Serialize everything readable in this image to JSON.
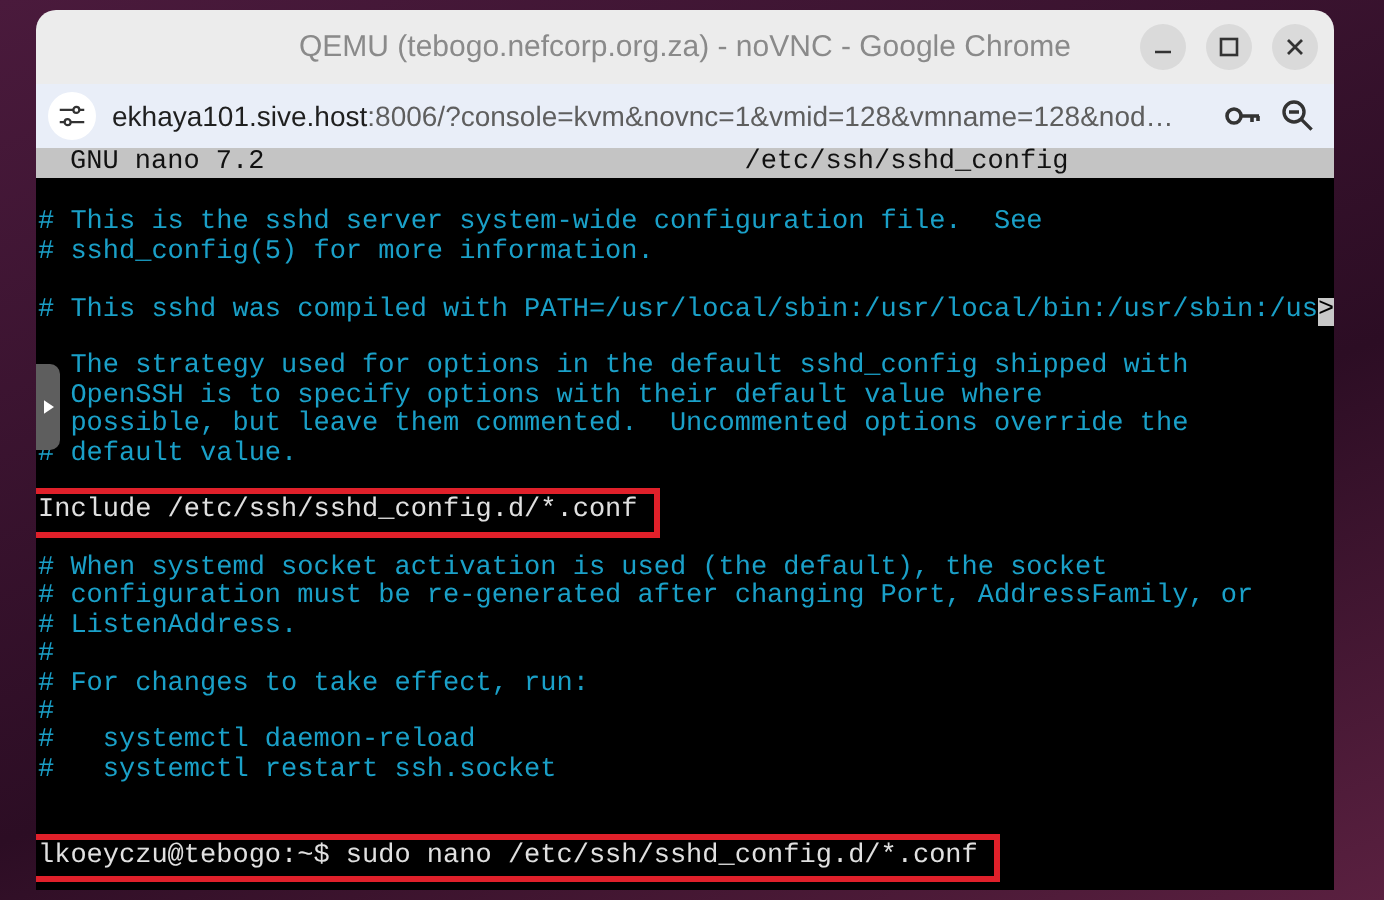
{
  "window": {
    "title": "QEMU (tebogo.nefcorp.org.za) - noVNC - Google Chrome"
  },
  "address_bar": {
    "host": "ekhaya101.sive.host",
    "rest": ":8006/?console=kvm&novnc=1&vmid=128&vmname=128&nod…"
  },
  "nano_header": {
    "version": "GNU nano 7.2",
    "file": "/etc/ssh/sshd_config"
  },
  "lines": [
    {
      "highlighted": false
    },
    {
      "text": "# This is the sshd server system-wide configuration file.  See",
      "highlighted": false
    },
    {
      "text": "# sshd_config(5) for more information.",
      "highlighted": false
    },
    {
      "highlighted": false
    },
    {
      "text": "# This sshd was compiled with PATH=/usr/local/sbin:/usr/local/bin:/usr/sbin:/us",
      "highlighted": false,
      "overflow_marker": ">"
    },
    {
      "highlighted": false
    },
    {
      "text": "  The strategy used for options in the default sshd_config shipped with",
      "highlighted": false
    },
    {
      "text": "  OpenSSH is to specify options with their default value where",
      "highlighted": false
    },
    {
      "text": "  possible, but leave them commented.  Uncommented options override the",
      "highlighted": false
    },
    {
      "text": "# default value.",
      "highlighted": false
    },
    {
      "highlighted": false
    },
    {
      "text": "Include /etc/ssh/sshd_config.d/*.conf",
      "highlighted": true
    },
    {
      "highlighted": false
    },
    {
      "text": "# When systemd socket activation is used (the default), the socket",
      "highlighted": false
    },
    {
      "text": "# configuration must be re-generated after changing Port, AddressFamily, or",
      "highlighted": false
    },
    {
      "text": "# ListenAddress.",
      "highlighted": false
    },
    {
      "text": "#",
      "highlighted": false
    },
    {
      "text": "# For changes to take effect, run:",
      "highlighted": false
    },
    {
      "text": "#",
      "highlighted": false
    },
    {
      "text": "#   systemctl daemon-reload",
      "highlighted": false
    },
    {
      "text": "#   systemctl restart ssh.socket",
      "highlighted": false
    },
    {
      "highlighted": false
    },
    {
      "highlighted": false
    },
    {
      "text": "lkoeyczu@tebogo:~$ sudo nano /etc/ssh/sshd_config.d/*.conf",
      "highlighted": true
    }
  ]
}
